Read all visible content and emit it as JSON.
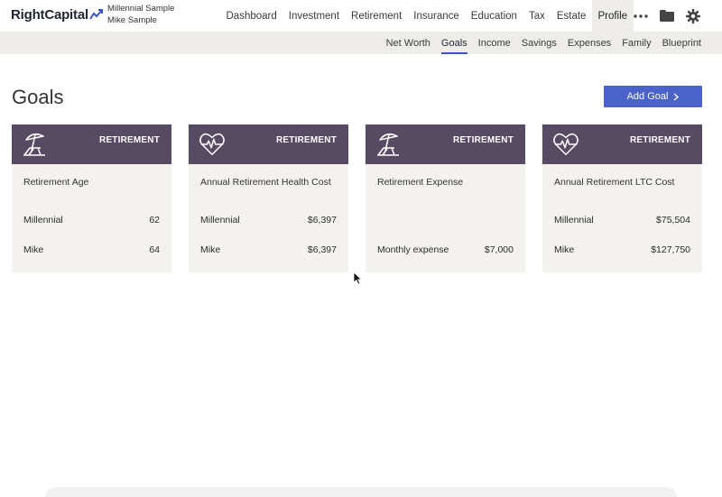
{
  "app": {
    "brand": "RightCapital"
  },
  "clients": {
    "primary": "Millennial Sample",
    "secondary": "Mike Sample"
  },
  "nav": {
    "items": [
      {
        "label": "Dashboard"
      },
      {
        "label": "Investment"
      },
      {
        "label": "Retirement"
      },
      {
        "label": "Insurance"
      },
      {
        "label": "Education"
      },
      {
        "label": "Tax"
      },
      {
        "label": "Estate"
      },
      {
        "label": "Profile",
        "active": true
      }
    ],
    "icons": [
      "more-icon",
      "folder-icon",
      "gear-icon"
    ]
  },
  "subnav": {
    "items": [
      {
        "label": "Net Worth"
      },
      {
        "label": "Goals",
        "active": true
      },
      {
        "label": "Income"
      },
      {
        "label": "Savings"
      },
      {
        "label": "Expenses"
      },
      {
        "label": "Family"
      },
      {
        "label": "Blueprint"
      }
    ]
  },
  "page": {
    "title": "Goals",
    "add_button": "Add Goal"
  },
  "cards": [
    {
      "icon": "beach-umbrella-icon",
      "badge": "RETIREMENT",
      "title": "Retirement Age",
      "rows": [
        {
          "label": "Millennial",
          "value": "62"
        },
        {
          "label": "Mike",
          "value": "64"
        }
      ]
    },
    {
      "icon": "heart-pulse-icon",
      "badge": "RETIREMENT",
      "title": "Annual Retirement Health Cost",
      "rows": [
        {
          "label": "Millennial",
          "value": "$6,397"
        },
        {
          "label": "Mike",
          "value": "$6,397"
        }
      ]
    },
    {
      "icon": "beach-umbrella-icon",
      "badge": "RETIREMENT",
      "title": "Retirement Expense",
      "rows": [
        {
          "label": "",
          "value": ""
        },
        {
          "label": "Monthly expense",
          "value": "$7,000"
        }
      ]
    },
    {
      "icon": "heart-pulse-icon",
      "badge": "RETIREMENT",
      "title": "Annual Retirement LTC Cost",
      "rows": [
        {
          "label": "Millennial",
          "value": "$75,504"
        },
        {
          "label": "Mike",
          "value": "$127,750"
        }
      ]
    }
  ],
  "colors": {
    "accent": "#4a62c9",
    "card_header": "#574a63",
    "card_body": "#f4f2ee",
    "subbar": "#eeede9"
  }
}
